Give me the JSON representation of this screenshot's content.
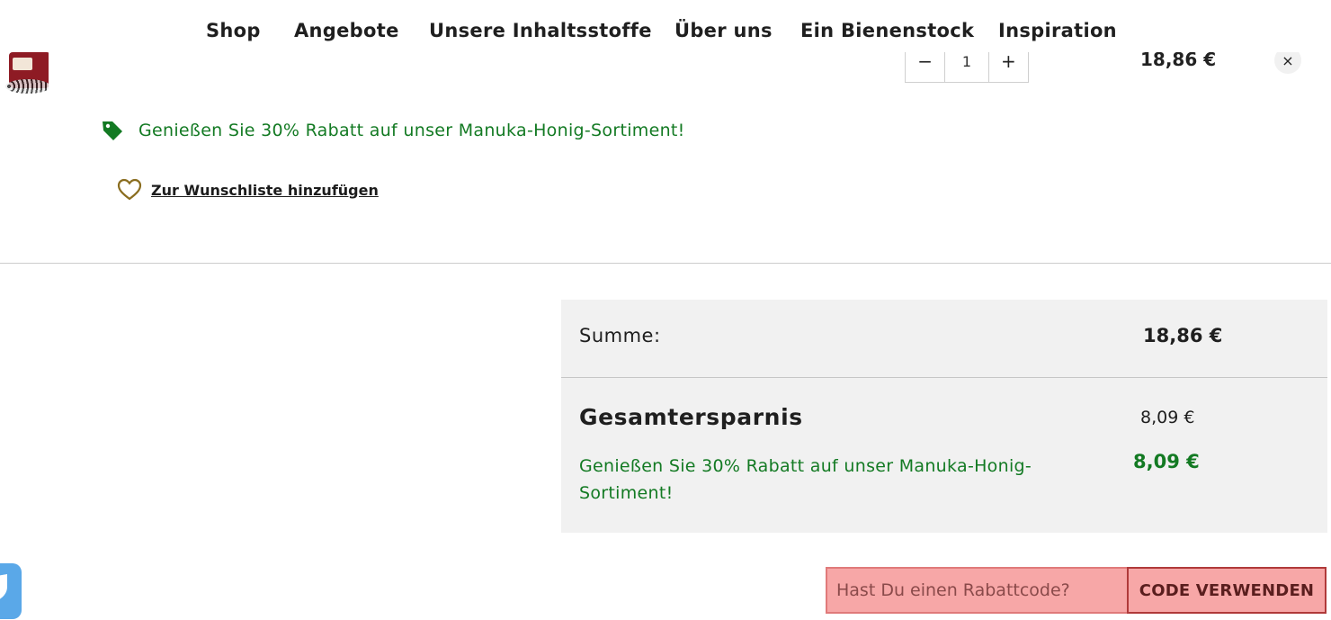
{
  "nav": {
    "items": [
      "Shop",
      "Angebote",
      "Unsere Inhaltsstoffe",
      "Über uns",
      "Ein Bienenstock",
      "Inspiration"
    ]
  },
  "cart_item": {
    "image_alt": "Manuka Honey",
    "quantity": "1",
    "decrement_label": "−",
    "increment_label": "+",
    "price": "18,86 €",
    "remove_label": "×",
    "promo_text": "Genießen Sie 30% Rabatt auf unser Manuka-Honig-Sortiment!",
    "wishlist_label": "Zur Wunschliste hinzufügen"
  },
  "summary": {
    "sum_label": "Summe:",
    "sum_value": "18,86 €",
    "savings_label": "Gesamtersparnis",
    "savings_value": "8,09 €",
    "promo_description": "Genießen Sie 30% Rabatt auf unser Manuka-Honig-Sortiment!",
    "promo_value": "8,09 €"
  },
  "coupon": {
    "placeholder": "Hast Du einen Rabattcode?",
    "button_label": "CODE VERWENDEN"
  },
  "colors": {
    "promo_green": "#137a23",
    "summary_bg": "#f1f1f1",
    "coupon_highlight": "#f7a7a7",
    "wishlist_heart": "#8a6d1f",
    "chat_blue": "#5aa8e8"
  },
  "icons": {
    "tag": "tag-icon",
    "heart": "heart-icon",
    "close": "close-icon",
    "chat": "chat-shield-icon"
  }
}
